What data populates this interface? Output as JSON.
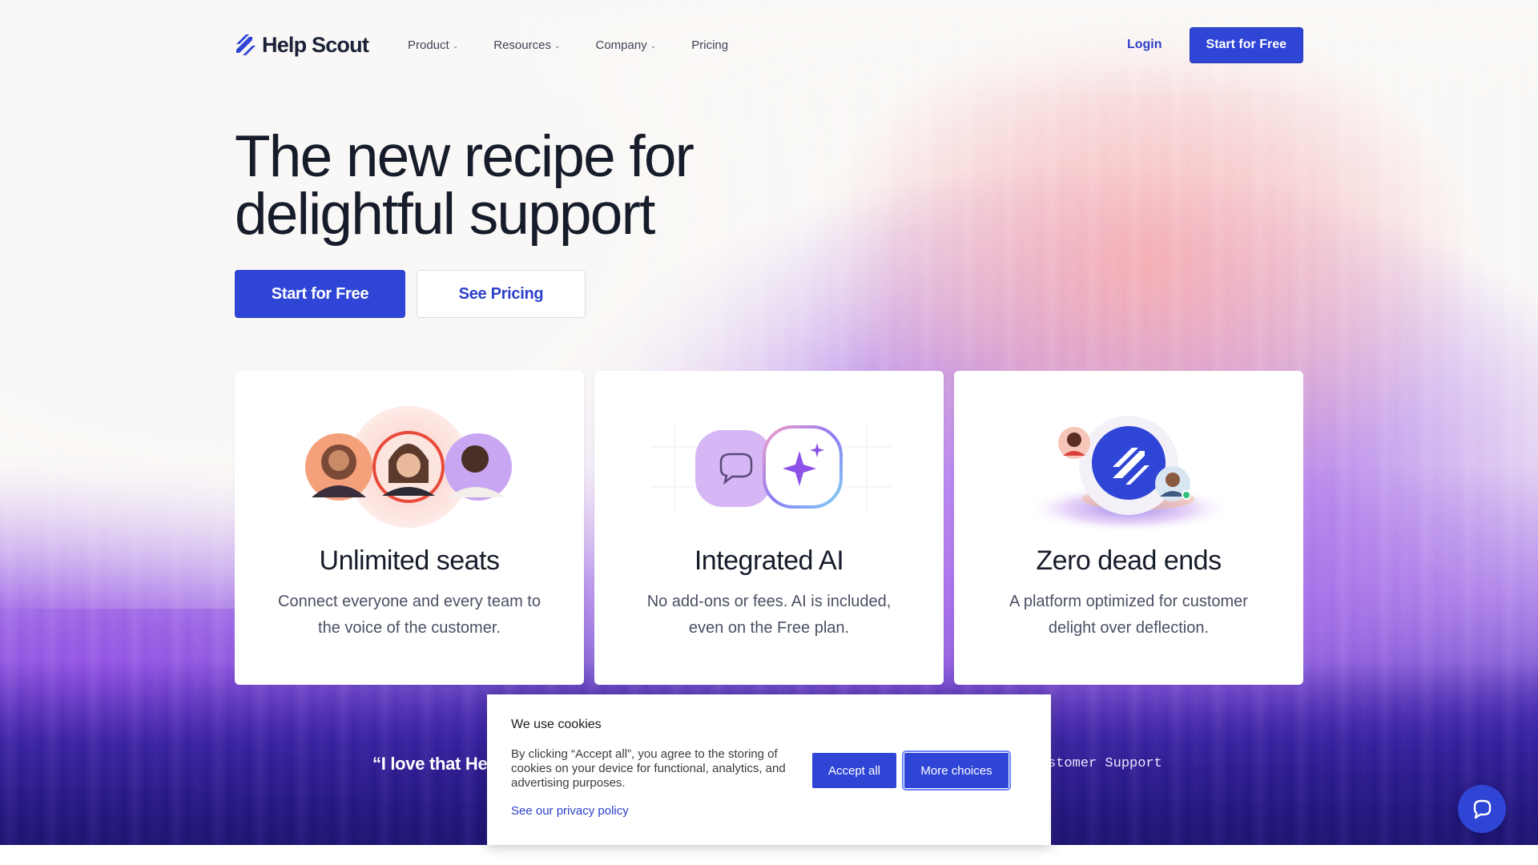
{
  "brand": {
    "name": "Help Scout",
    "logo_icon": "help-scout-slashes-icon",
    "accent": "#2f45d6"
  },
  "nav": {
    "items": [
      {
        "label": "Product",
        "has_dropdown": true
      },
      {
        "label": "Resources",
        "has_dropdown": true
      },
      {
        "label": "Company",
        "has_dropdown": true
      },
      {
        "label": "Pricing",
        "has_dropdown": false
      }
    ],
    "chevron": "⌄",
    "login": "Login",
    "cta": "Start for Free"
  },
  "hero": {
    "title_line1": "The new recipe for",
    "title_line2": "delightful support",
    "primary_cta": "Start for Free",
    "secondary_cta": "See Pricing"
  },
  "cards": [
    {
      "title": "Unlimited seats",
      "description": "Connect everyone and every team to the voice of the customer.",
      "icon": "team-avatars-icon"
    },
    {
      "title": "Integrated AI",
      "description": "No add-ons or fees. AI is included, even on the Free plan.",
      "icon": "chat-sparkle-icon"
    },
    {
      "title": "Zero dead ends",
      "description": "A platform optimized for customer delight over deflection.",
      "icon": "help-scout-badge-icon"
    }
  ],
  "testimonial": {
    "quote_visible": "“I love that He",
    "attribution_visible": "stomer Support"
  },
  "cookie": {
    "title": "We use cookies",
    "text": "By clicking “Accept all”, you agree to the storing of cookies on your device for functional, analytics, and advertising purposes.",
    "privacy_link": "See our privacy policy",
    "accept": "Accept all",
    "more": "More choices"
  },
  "beacon": {
    "icon": "chat-bubble-icon"
  }
}
